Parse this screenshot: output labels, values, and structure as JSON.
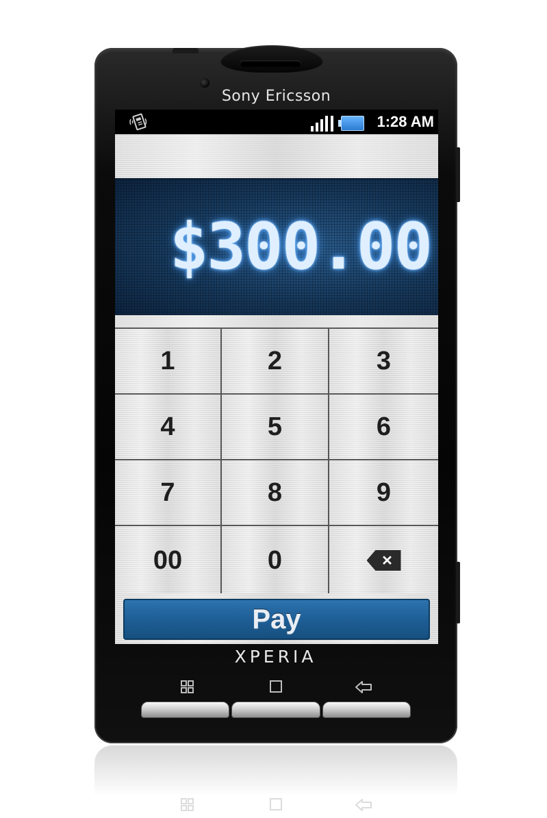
{
  "device": {
    "brand": "Sony Ericsson",
    "model_label": "XPERIA"
  },
  "status_bar": {
    "time": "1:28 AM",
    "left_icon": "nfc-terminal-icon",
    "signal_icon": "signal-bars-icon",
    "battery_icon": "battery-icon"
  },
  "amount": {
    "value": "$300.00"
  },
  "keypad": {
    "keys": [
      "1",
      "2",
      "3",
      "4",
      "5",
      "6",
      "7",
      "8",
      "9",
      "00",
      "0"
    ],
    "backspace_icon": "backspace-icon",
    "backspace_glyph": "✕"
  },
  "pay_button": {
    "label": "Pay"
  },
  "nav_buttons": [
    "menu-grid-icon",
    "home-square-icon",
    "back-arrow-icon"
  ],
  "colors": {
    "display_blue": "#173a5e",
    "pay_blue": "#1e5e96",
    "glow": "#6fb6ff"
  }
}
